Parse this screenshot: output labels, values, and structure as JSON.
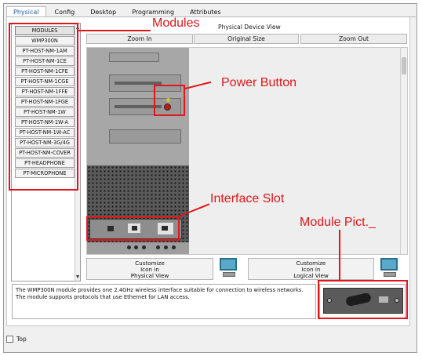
{
  "tabs": [
    "Physical",
    "Config",
    "Desktop",
    "Programming",
    "Attributes"
  ],
  "modules": {
    "header": "MODULES",
    "items": [
      "WMP300N",
      "PT-HOST-NM-1AM",
      "PT-HOST-NM-1CE",
      "PT-HOST-NM-1CFE",
      "PT-HOST-NM-1CGE",
      "PT-HOST-NM-1FFE",
      "PT-HOST-NM-1FGE",
      "PT-HOST-NM-1W",
      "PT-HOST-NM-1W-A",
      "PT-HOST-NM-1W-AC",
      "PT-HOST-NM-3G/4G",
      "PT-HOST-NM-COVER",
      "PT-HEADPHONE",
      "PT-MICROPHONE"
    ]
  },
  "physical": {
    "title": "Physical Device View",
    "zoom_in": "Zoom In",
    "original_size": "Original Size",
    "zoom_out": "Zoom Out"
  },
  "customize": {
    "physical_line1": "Customize",
    "physical_line2": "Icon in",
    "physical_line3": "Physical View",
    "logical_line1": "Customize",
    "logical_line2": "Icon in",
    "logical_line3": "Logical View"
  },
  "description": {
    "line1": "The WMP300N module provides one 2.4GHz wireless interface suitable for connection to wireless networks.",
    "line2": "The module supports protocols that use Ethernet for LAN access."
  },
  "annotations": {
    "modules": "Modules",
    "power_button": "Power Button",
    "interface_slot": "Interface Slot",
    "module_pict": "Module Pict._"
  },
  "bottom": {
    "top_label": "Top"
  },
  "colors": {
    "annotation": "#e0161b",
    "active_tab": "#1a5fb4"
  }
}
